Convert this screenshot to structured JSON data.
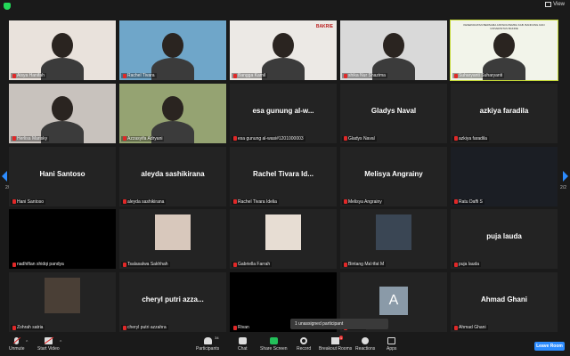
{
  "topbar": {
    "view_label": "View"
  },
  "pagination": {
    "left": "2/2",
    "right": "2/2"
  },
  "tiles": [
    {
      "row": 0,
      "col": 0,
      "label": "Aisya Hanifah",
      "kind": "video",
      "bg": "#e9e2dc",
      "active": false
    },
    {
      "row": 0,
      "col": 1,
      "label": "Rachel Tivara",
      "kind": "video",
      "bg": "#6fa6c9",
      "active": false
    },
    {
      "row": 0,
      "col": 2,
      "label": "Bangga Kamil",
      "kind": "video",
      "bg": "#ece9e5",
      "active": false,
      "logo": "BAKRIE"
    },
    {
      "row": 0,
      "col": 3,
      "label": "shika Nur Shazima",
      "kind": "video",
      "bg": "#d9d9d9",
      "active": false
    },
    {
      "row": 0,
      "col": 4,
      "label": "Suharyanti Suharyanti",
      "kind": "video",
      "bg": "#f2f4ea",
      "active": true,
      "banner": "KESEPAKATAN BERSAMA ANTARA PEMDA KAB. BANDUNG DAN UNIVERSITAS BAKRIE"
    },
    {
      "row": 1,
      "col": 0,
      "label": "Herlisa Marisky",
      "kind": "video",
      "bg": "#c8c2bd",
      "active": false
    },
    {
      "row": 1,
      "col": 1,
      "label": "Azzasyifa Adryani",
      "kind": "video",
      "bg": "#95a372",
      "active": false
    },
    {
      "row": 1,
      "col": 2,
      "label": "esa gunung al-wasi#1201000003",
      "kind": "name",
      "bigname": "esa gunung al-w...",
      "active": false
    },
    {
      "row": 1,
      "col": 3,
      "label": "Gladys Naval",
      "kind": "name",
      "bigname": "Gladys Naval",
      "active": false
    },
    {
      "row": 1,
      "col": 4,
      "label": "azkiya faradila",
      "kind": "name",
      "bigname": "azkiya faradila",
      "active": false
    },
    {
      "row": 2,
      "col": 0,
      "label": "Hani Santoso",
      "kind": "name",
      "bigname": "Hani Santoso",
      "active": false
    },
    {
      "row": 2,
      "col": 1,
      "label": "aleyda sashikirana",
      "kind": "name",
      "bigname": "aleyda sashikirana",
      "active": false
    },
    {
      "row": 2,
      "col": 2,
      "label": "Rachel Tivara Idelia",
      "kind": "name",
      "bigname": "Rachel Tivara Id...",
      "active": false
    },
    {
      "row": 2,
      "col": 3,
      "label": "Melisya Angrainy",
      "kind": "name",
      "bigname": "Melisya Angrainy",
      "active": false
    },
    {
      "row": 2,
      "col": 4,
      "label": "Ratu Daffi S",
      "kind": "video",
      "bg": "#1b1e24",
      "active": false
    },
    {
      "row": 3,
      "col": 0,
      "label": "nadhiftan shidqi pandya",
      "kind": "video",
      "bg": "#000000",
      "active": false
    },
    {
      "row": 3,
      "col": 1,
      "label": "Tsalasalwa Sakhhah",
      "kind": "photo",
      "bg": "#d8c8bc",
      "active": false
    },
    {
      "row": 3,
      "col": 2,
      "label": "Gabriella Farrah",
      "kind": "photo",
      "bg": "#e7ddd3",
      "active": false
    },
    {
      "row": 3,
      "col": 3,
      "label": "Bintang Ma'rifat M",
      "kind": "photo",
      "bg": "#3a4654",
      "active": false
    },
    {
      "row": 3,
      "col": 4,
      "label": "puja lauda",
      "kind": "name",
      "bigname": "puja lauda",
      "active": false
    },
    {
      "row": 4,
      "col": 0,
      "label": "Zohrah satria",
      "kind": "photo",
      "bg": "#4a3f36",
      "active": false
    },
    {
      "row": 4,
      "col": 1,
      "label": "cheryl putri azzahra",
      "kind": "name",
      "bigname": "cheryl putri azza...",
      "active": false
    },
    {
      "row": 4,
      "col": 2,
      "label": "Rivan",
      "kind": "video",
      "bg": "#000000",
      "active": false
    },
    {
      "row": 4,
      "col": 3,
      "label": "madhan",
      "kind": "avatar",
      "avatar_letter": "A",
      "active": false
    },
    {
      "row": 4,
      "col": 4,
      "label": "Ahmad Ghani",
      "kind": "name",
      "bigname": "Ahmad Ghani",
      "active": false
    }
  ],
  "unassigned": "1 unassigned participant",
  "toolbar": {
    "unmute": "Unmute",
    "start_video": "Start Video",
    "participants": "Participants",
    "participants_count": "34",
    "chat": "Chat",
    "share_screen": "Share Screen",
    "record": "Record",
    "breakout_rooms": "Breakout Rooms",
    "breakout_badge": "1",
    "reactions": "Reactions",
    "apps": "Apps",
    "leave": "Leave Room"
  },
  "colors": {
    "accent": "#2d8cff",
    "active_border": "#c5d937",
    "mic_off": "#e02828",
    "share": "#23c05a"
  }
}
